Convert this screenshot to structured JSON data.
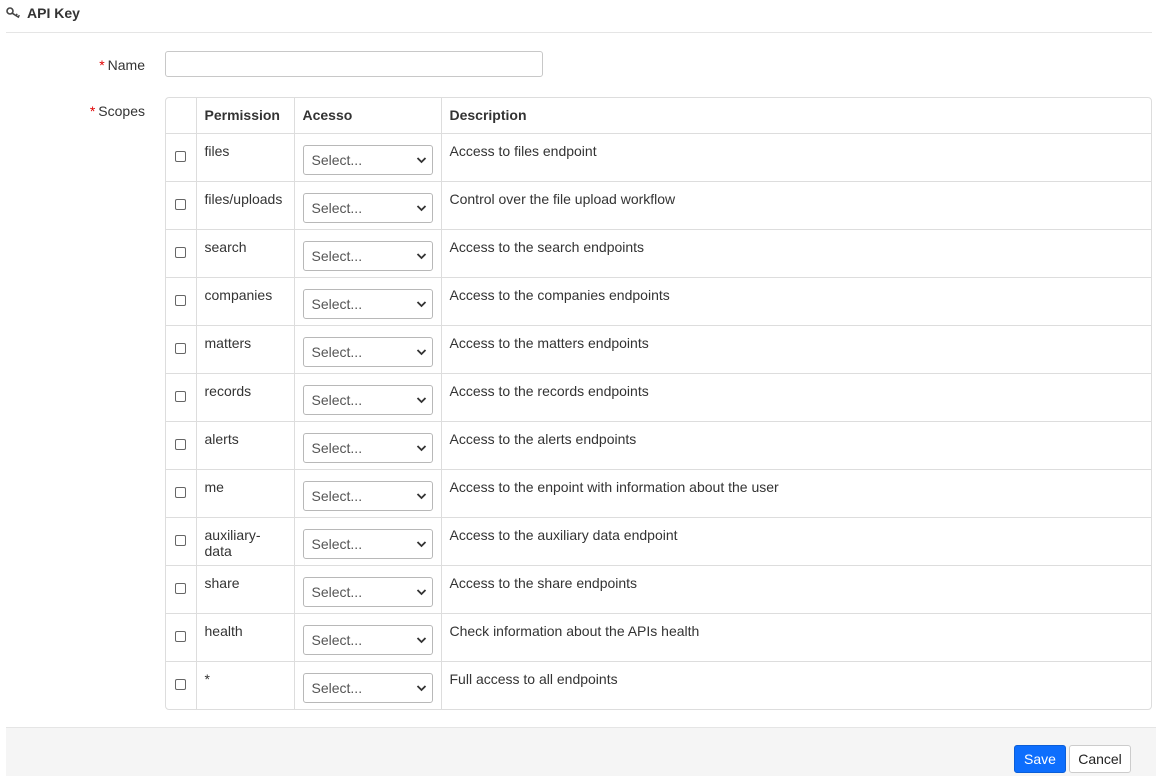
{
  "header": {
    "title": "API Key",
    "icon": "key-icon"
  },
  "form": {
    "name_label": "Name",
    "name_value": "",
    "name_placeholder": "",
    "scopes_label": "Scopes",
    "required_mark": "*"
  },
  "table": {
    "columns": [
      "",
      "Permission",
      "Acesso",
      "Description"
    ],
    "rows": [
      {
        "permission": "files",
        "access": "Select...",
        "description": "Access to files endpoint"
      },
      {
        "permission": "files/uploads",
        "access": "Select...",
        "description": "Control over the file upload workflow"
      },
      {
        "permission": "search",
        "access": "Select...",
        "description": "Access to the search endpoints"
      },
      {
        "permission": "companies",
        "access": "Select...",
        "description": "Access to the companies endpoints"
      },
      {
        "permission": "matters",
        "access": "Select...",
        "description": "Access to the matters endpoints"
      },
      {
        "permission": "records",
        "access": "Select...",
        "description": "Access to the records endpoints"
      },
      {
        "permission": "alerts",
        "access": "Select...",
        "description": "Access to the alerts endpoints"
      },
      {
        "permission": "me",
        "access": "Select...",
        "description": "Access to the enpoint with information about the user"
      },
      {
        "permission": "auxiliary-data",
        "access": "Select...",
        "description": "Access to the auxiliary data endpoint"
      },
      {
        "permission": "share",
        "access": "Select...",
        "description": "Access to the share endpoints"
      },
      {
        "permission": "health",
        "access": "Select...",
        "description": "Check information about the APIs health"
      },
      {
        "permission": "*",
        "access": "Select...",
        "description": "Full access to all endpoints"
      }
    ]
  },
  "footer": {
    "save_label": "Save",
    "cancel_label": "Cancel"
  },
  "colors": {
    "primary": "#0d6efd",
    "required": "#e00000",
    "footer_bg": "#f5f5f5"
  }
}
